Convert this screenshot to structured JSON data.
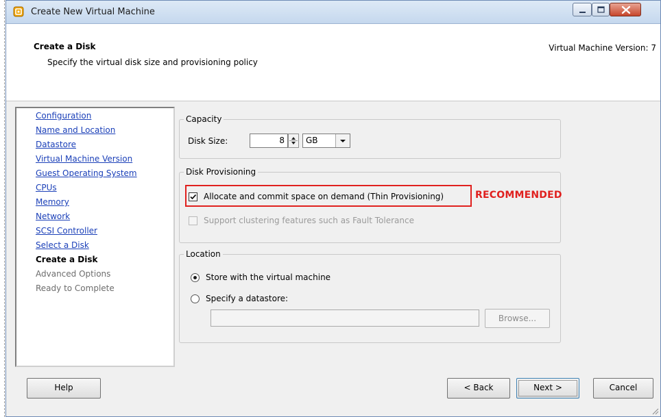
{
  "window": {
    "title": "Create New Virtual Machine"
  },
  "header": {
    "title": "Create a Disk",
    "subtitle": "Specify the virtual disk size and provisioning policy",
    "version": "Virtual Machine Version: 7"
  },
  "nav": {
    "items": [
      {
        "label": "Configuration",
        "state": "link"
      },
      {
        "label": "Name and Location",
        "state": "link"
      },
      {
        "label": "Datastore",
        "state": "link"
      },
      {
        "label": "Virtual Machine Version",
        "state": "link"
      },
      {
        "label": "Guest Operating System",
        "state": "link"
      },
      {
        "label": "CPUs",
        "state": "link"
      },
      {
        "label": "Memory",
        "state": "link"
      },
      {
        "label": "Network",
        "state": "link"
      },
      {
        "label": "SCSI Controller",
        "state": "link"
      },
      {
        "label": "Select a Disk",
        "state": "link"
      },
      {
        "label": "Create a Disk",
        "state": "current"
      },
      {
        "label": "Advanced Options",
        "state": "disabled"
      },
      {
        "label": "Ready to Complete",
        "state": "disabled"
      }
    ]
  },
  "capacity": {
    "group_label": "Capacity",
    "disk_size_label": "Disk Size:",
    "disk_size_value": "8",
    "unit": "GB"
  },
  "provisioning": {
    "group_label": "Disk Provisioning",
    "thin_label": "Allocate and commit space on demand (Thin Provisioning)",
    "thin_checked": true,
    "clustering_label": "Support clustering features such as Fault Tolerance",
    "clustering_checked": false,
    "annotation": "RECOMMENDED",
    "annotation_color": "#e0201e"
  },
  "location": {
    "group_label": "Location",
    "store_with_vm": "Store with the virtual machine",
    "specify_datastore": "Specify a datastore:",
    "selected": "store_with_vm",
    "datastore_path": "",
    "browse_label": "Browse..."
  },
  "footer": {
    "help": "Help",
    "back": "< Back",
    "next": "Next >",
    "cancel": "Cancel"
  }
}
